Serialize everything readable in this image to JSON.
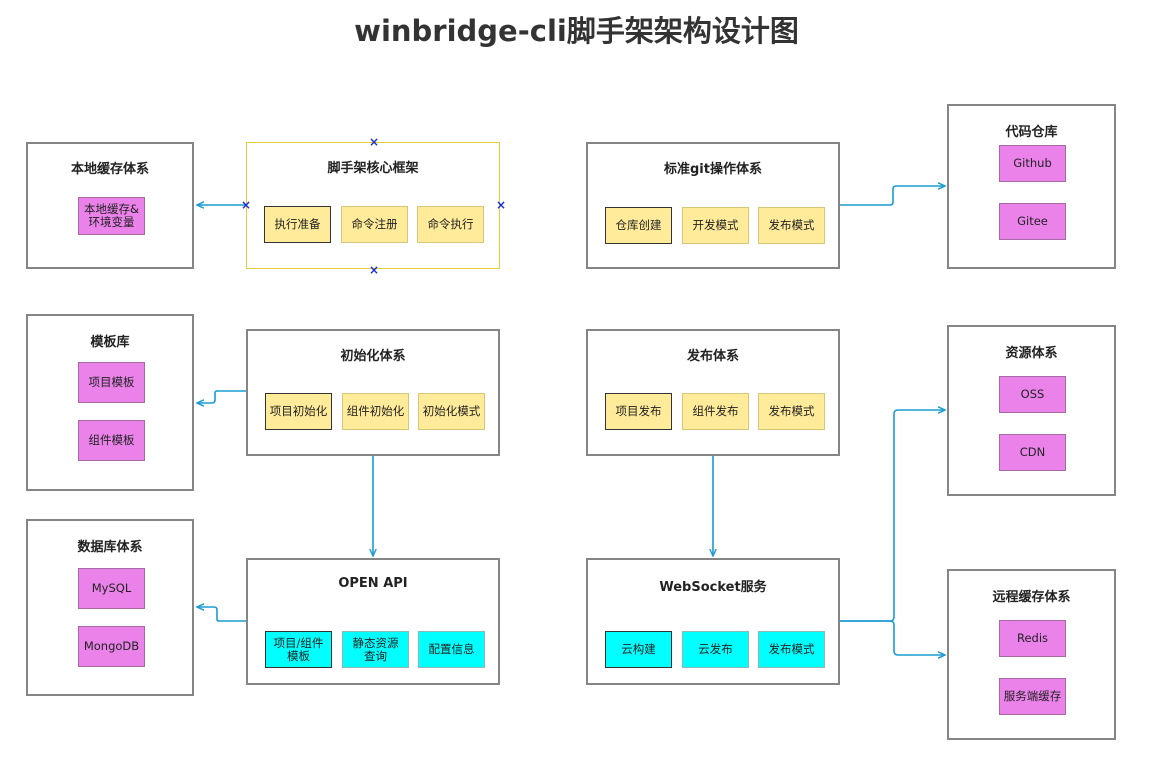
{
  "title": "winbridge-cli脚手架架构设计图",
  "colors": {
    "border": "#858585",
    "selection": "#e0cf3b",
    "arrow": "#1a9bd1",
    "yellow_item": "#ffeb99",
    "cyan_item": "#00ffff",
    "pink_item": "#ea82ea"
  },
  "boxes": {
    "local_cache": {
      "title": "本地缓存体系",
      "items": [
        "本地缓存&\n环境变量"
      ]
    },
    "core": {
      "title": "脚手架核心框架",
      "items": [
        "执行准备",
        "命令注册",
        "命令执行"
      ]
    },
    "git": {
      "title": "标准git操作体系",
      "items": [
        "仓库创建",
        "开发模式",
        "发布模式"
      ]
    },
    "repo": {
      "title": "代码仓库",
      "items": [
        "Github",
        "Gitee"
      ]
    },
    "template": {
      "title": "模板库",
      "items": [
        "项目模板",
        "组件模板"
      ]
    },
    "init": {
      "title": "初始化体系",
      "items": [
        "项目初始化",
        "组件初始化",
        "初始化模式"
      ]
    },
    "publish": {
      "title": "发布体系",
      "items": [
        "项目发布",
        "组件发布",
        "发布模式"
      ]
    },
    "resource": {
      "title": "资源体系",
      "items": [
        "OSS",
        "CDN"
      ]
    },
    "database": {
      "title": "数据库体系",
      "items": [
        "MySQL",
        "MongoDB"
      ]
    },
    "openapi": {
      "title": "OPEN API",
      "items": [
        "项目/组件\n模板",
        "静态资源\n查询",
        "配置信息"
      ]
    },
    "websocket": {
      "title": "WebSocket服务",
      "items": [
        "云构建",
        "云发布",
        "发布模式"
      ]
    },
    "remote_cache": {
      "title": "远程缓存体系",
      "items": [
        "Redis",
        "服务端缓存"
      ]
    }
  }
}
